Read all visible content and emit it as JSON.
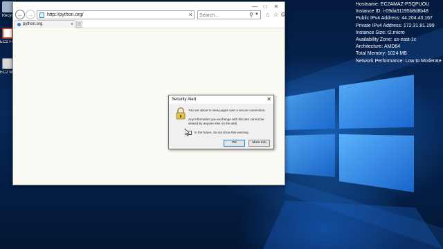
{
  "desktop": {
    "icons": [
      {
        "label": "Recyc",
        "icon": "recycle-bin-icon"
      },
      {
        "label": "EC2 Feedb",
        "icon": "ec2-feedback-icon"
      },
      {
        "label": "EC2 Micro",
        "icon": "ec2-microsoft-icon"
      }
    ],
    "bginfo": [
      "Hostname: EC2AMAZ-PSQPUOU",
      "Instance ID: i-09da31195b8d8b48",
      "Public IPv4 Address: 44.204.43.167",
      "Private IPv4 Address: 172.31.81.199",
      "Instance Size: t2.micro",
      "Availability Zone: us-east-1c",
      "Architecture: AMD64",
      "Total Memory: 1024 MB",
      "Network Performance: Low to Moderate"
    ]
  },
  "browser": {
    "address": "http://python.org/",
    "search_placeholder": "Search...",
    "tab_label": "python.org",
    "toolbar_icons": [
      "home-icon",
      "favorites-star-icon",
      "settings-gear-icon",
      "feedback-smiley-icon"
    ]
  },
  "dialog": {
    "title": "Security Alert",
    "message_1": "You are about to view pages over a secure connection.",
    "message_2": "Any information you exchange with this site cannot be viewed by anyone else on the web.",
    "checkbox_label": "In the future, do not show this warning",
    "ok_label": "OK",
    "more_info_label": "More Info"
  },
  "colors": {
    "wallpaper": "#06285a",
    "dialog_bg": "#f0f0f0",
    "ok_border": "#3c7fb1"
  }
}
